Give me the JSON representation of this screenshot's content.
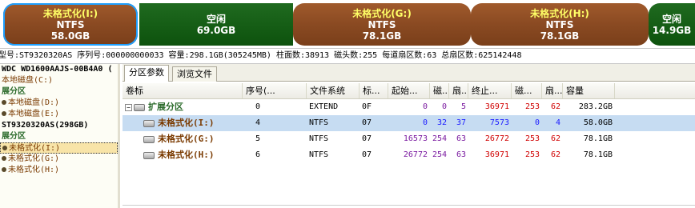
{
  "diskmap": {
    "segments": [
      {
        "label": "未格式化(I:)",
        "fs": "NTFS",
        "size": "58.0GB"
      },
      {
        "label": "空闲",
        "fs": "",
        "size": "69.0GB"
      },
      {
        "label": "未格式化(G:)",
        "fs": "NTFS",
        "size": "78.1GB"
      },
      {
        "label": "未格式化(H:)",
        "fs": "NTFS",
        "size": "78.1GB"
      },
      {
        "label": "空闲",
        "fs": "",
        "size": "14.9GB"
      }
    ]
  },
  "infobar": {
    "text": "型号:ST9320320AS  序列号:000000000033  容量:298.1GB(305245MB)  柱面数:38913  磁头数:255  每道扇区数:63  总扇区数:625142448"
  },
  "tree": {
    "items": [
      {
        "label": "WDC WD1600AAJS-00B4A0 (",
        "style": "bold"
      },
      {
        "label": "本地磁盘(C:)",
        "style": "brown"
      },
      {
        "label": "展分区",
        "style": "green"
      },
      {
        "label": "本地磁盘(D:)",
        "style": "brown"
      },
      {
        "label": "本地磁盘(E:)",
        "style": "brown"
      },
      {
        "label": "ST9320320AS(298GB)",
        "style": "bold"
      },
      {
        "label": "展分区",
        "style": "green"
      },
      {
        "label": "未格式化(I:)",
        "style": "brown"
      },
      {
        "label": "未格式化(G:)",
        "style": "brown"
      },
      {
        "label": "未格式化(H:)",
        "style": "brown"
      }
    ]
  },
  "tabs": [
    "分区参数",
    "浏览文件"
  ],
  "table": {
    "headers": [
      "卷标",
      "序号(...",
      "文件系统",
      "标...",
      "起始...",
      "磁...",
      "扇...",
      "终止...",
      "磁...",
      "扇...",
      "容量"
    ],
    "rows": [
      {
        "name": "扩展分区",
        "seq": "0",
        "fs": "EXTEND",
        "id": "0F",
        "sc": "0",
        "sh": "0",
        "ss": "5",
        "ec": "36971",
        "eh": "253",
        "es": "62",
        "cap": "283.2GB"
      },
      {
        "name": "未格式化(I:)",
        "seq": "4",
        "fs": "NTFS",
        "id": "07",
        "sc": "0",
        "sh": "32",
        "ss": "37",
        "ec": "7573",
        "eh": "0",
        "es": "4",
        "cap": "58.0GB"
      },
      {
        "name": "未格式化(G:)",
        "seq": "5",
        "fs": "NTFS",
        "id": "07",
        "sc": "16573",
        "sh": "254",
        "ss": "63",
        "ec": "26772",
        "eh": "253",
        "es": "62",
        "cap": "78.1GB"
      },
      {
        "name": "未格式化(H:)",
        "seq": "6",
        "fs": "NTFS",
        "id": "07",
        "sc": "26772",
        "sh": "254",
        "ss": "63",
        "ec": "36971",
        "eh": "253",
        "es": "62",
        "cap": "78.1GB"
      }
    ]
  }
}
